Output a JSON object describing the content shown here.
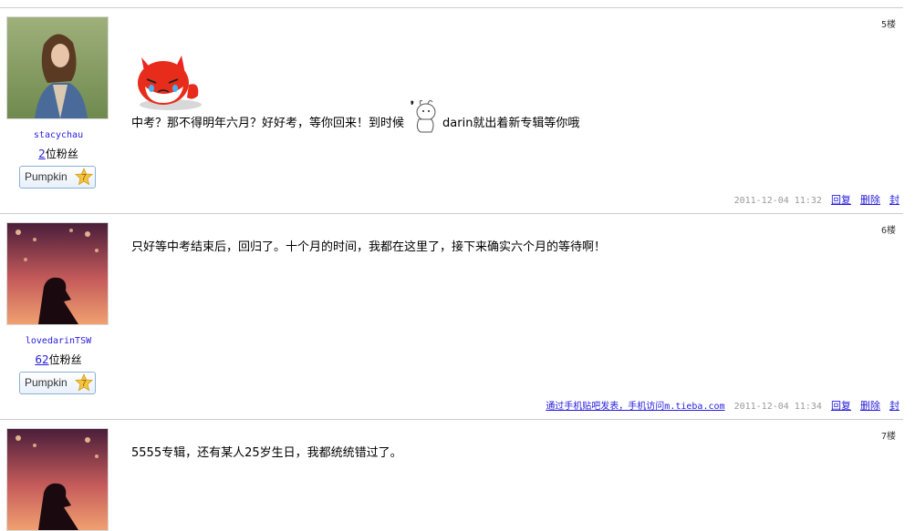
{
  "posts": [
    {
      "floor": "5楼",
      "username": "stacychau",
      "fans_count": "2",
      "fans_suffix": "位粉丝",
      "badge_label": "Pumpkin",
      "badge_level": "7",
      "content_part1": "中考？那不得明年六月？好好考，等你回来！到时候",
      "content_part2": "darin就出着新专辑等你哦",
      "mobile_note": "",
      "time": "2011-12-04 11:32",
      "reply": "回复",
      "delete": "删除",
      "ban": "封"
    },
    {
      "floor": "6楼",
      "username": "lovedarinTSW",
      "fans_count": "62",
      "fans_suffix": "位粉丝",
      "badge_label": "Pumpkin",
      "badge_level": "7",
      "content": "只好等中考结束后，回归了。十个月的时间，我都在这里了，接下来确实六个月的等待啊！",
      "mobile_note": "通过手机贴吧发表，手机访问m.tieba.com",
      "time": "2011-12-04 11:34",
      "reply": "回复",
      "delete": "删除",
      "ban": "封"
    },
    {
      "floor": "7楼",
      "content": "5555专辑，还有某人25岁生日，我都统统错过了。"
    }
  ],
  "colors": {
    "link": "#261cdc",
    "divider": "#cccccc",
    "meta_gray": "#999999"
  }
}
